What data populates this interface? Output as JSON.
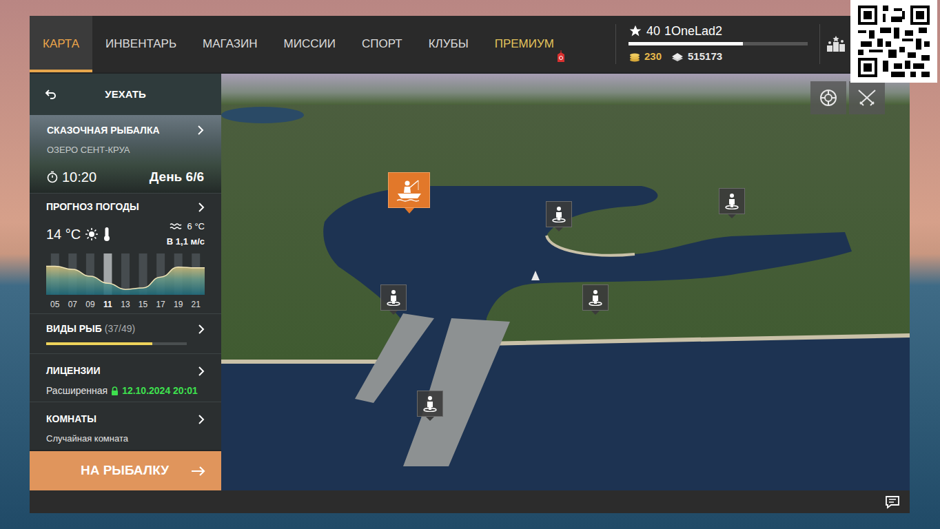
{
  "nav": {
    "tabs": [
      {
        "label": "КАРТА",
        "selected": true,
        "kind": "normal"
      },
      {
        "label": "ИНВЕНТАРЬ",
        "selected": false,
        "kind": "normal"
      },
      {
        "label": "МАГАЗИН",
        "selected": false,
        "kind": "normal"
      },
      {
        "label": "МИССИИ",
        "selected": false,
        "kind": "normal"
      },
      {
        "label": "СПОРТ",
        "selected": false,
        "kind": "normal"
      },
      {
        "label": "КЛУБЫ",
        "selected": false,
        "kind": "normal"
      },
      {
        "label": "ПРЕМИУМ",
        "selected": false,
        "kind": "premium"
      }
    ]
  },
  "profile": {
    "level": "40",
    "name": "1OneLad2",
    "xp_level": 0.64,
    "gold": "230",
    "silver": "515173"
  },
  "sidebar": {
    "back": {
      "label": "УЕХАТЬ"
    },
    "location": {
      "title": "СКАЗОЧНАЯ РЫБАЛКА",
      "subtitle": "ОЗЕРО СЕНТ-КРУА",
      "time": "10:20",
      "day": "День 6/6"
    },
    "weather": {
      "title": "ПРОГНОЗ ПОГОДЫ",
      "air_temp": "14 °C",
      "water_temp": "6 °C",
      "wind": "В 1,1 м/с",
      "hours": [
        {
          "label": "05",
          "selected": false
        },
        {
          "label": "07",
          "selected": false
        },
        {
          "label": "09",
          "selected": false
        },
        {
          "label": "11",
          "selected": true
        },
        {
          "label": "13",
          "selected": false
        },
        {
          "label": "15",
          "selected": false
        },
        {
          "label": "17",
          "selected": false
        },
        {
          "label": "19",
          "selected": false
        },
        {
          "label": "21",
          "selected": false
        }
      ],
      "curve": [
        0.74,
        0.66,
        0.48,
        0.3,
        0.14,
        0.18,
        0.46,
        0.72,
        0.7
      ]
    },
    "fish": {
      "title": "ВИДЫ РЫБ",
      "count": "(37/49)",
      "level": 0.755
    },
    "license": {
      "title": "ЛИЦЕНЗИИ",
      "type": "Расширенная",
      "expires": "12.10.2024 20:01"
    },
    "rooms": {
      "title": "КОМНАТЫ",
      "value": "Случайная комната"
    },
    "go_button": {
      "label": "НА РЫБАЛКУ"
    }
  },
  "map": {
    "pins": [
      {
        "kind": "boat",
        "selected": true
      },
      {
        "kind": "spot",
        "selected": false
      },
      {
        "kind": "spot",
        "selected": false
      },
      {
        "kind": "spot",
        "selected": false
      },
      {
        "kind": "spot",
        "selected": false
      },
      {
        "kind": "spot",
        "selected": false
      }
    ]
  }
}
